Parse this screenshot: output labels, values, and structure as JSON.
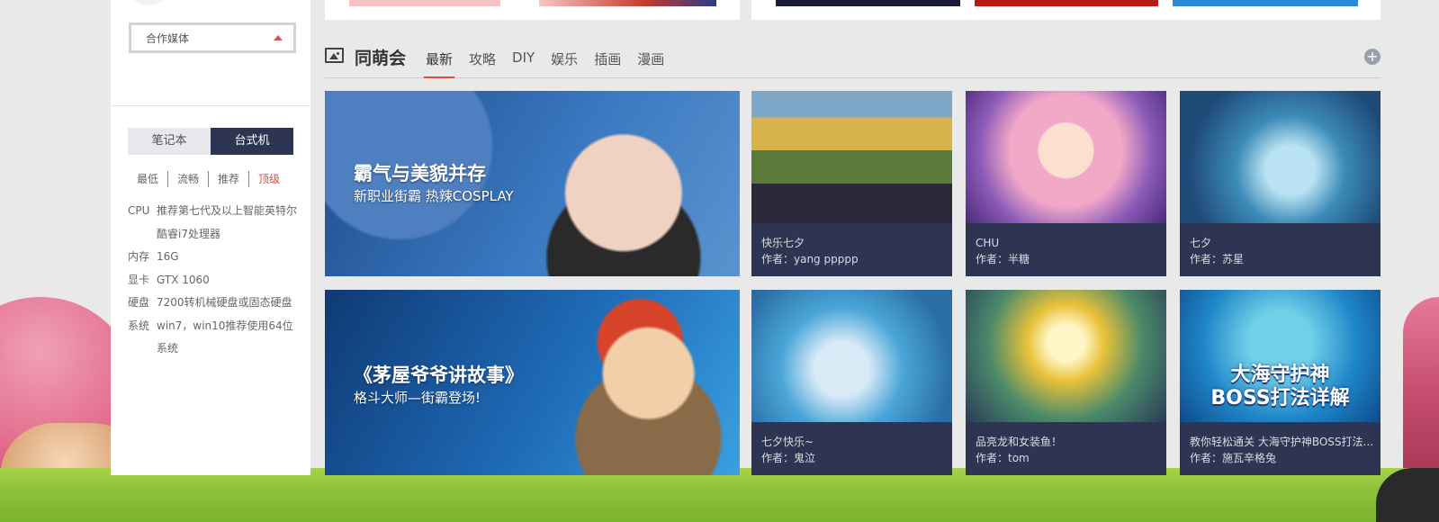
{
  "sidebar": {
    "partner_select": {
      "value": "合作媒体"
    },
    "device_tabs": [
      {
        "label": "笔记本",
        "active": false
      },
      {
        "label": "台式机",
        "active": true
      }
    ],
    "levels": [
      "最低",
      "流畅",
      "推荐",
      "顶级"
    ],
    "active_level": "顶级",
    "specs": [
      {
        "key": "CPU",
        "value": "推荐第七代及以上智能英特尔酷睿i7处理器"
      },
      {
        "key": "内存",
        "value": "16G"
      },
      {
        "key": "显卡",
        "value": "GTX 1060"
      },
      {
        "key": "硬盘",
        "value": "7200转机械硬盘或固态硬盘"
      },
      {
        "key": "系统",
        "value": "win7，win10推荐使用64位系统"
      }
    ]
  },
  "section": {
    "title": "同萌会",
    "icon": "image-icon",
    "tabs": [
      "最新",
      "攻略",
      "DIY",
      "娱乐",
      "插画",
      "漫画"
    ],
    "active_tab": "最新",
    "add_label": "+"
  },
  "banners": [
    {
      "title": "霸气与美貌并存",
      "subtitle": "新职业街霸  热辣COSPLAY"
    },
    {
      "title": "《茅屋爷爷讲故事》",
      "subtitle": "格斗大师—街霸登场!"
    }
  ],
  "cards": [
    {
      "title": "快乐七夕",
      "author": "作者：yang ppppp"
    },
    {
      "title": "CHU",
      "author": "作者：半糖"
    },
    {
      "title": "七夕",
      "author": "作者：苏星"
    },
    {
      "title": "七夕快乐~",
      "author": "作者：鬼泣"
    },
    {
      "title": "品亮龙和女装鱼！",
      "author": "作者：tom"
    },
    {
      "title": "教你轻松通关 大海守护神BOSS打法...",
      "author": "作者：施瓦辛格兔",
      "thumb_text": [
        "大海守护神",
        "BOSS打法详解"
      ]
    }
  ],
  "colors": {
    "accent": "#e64a3b",
    "dark_panel": "#2e3552",
    "page_bg": "#e9e9e9"
  }
}
